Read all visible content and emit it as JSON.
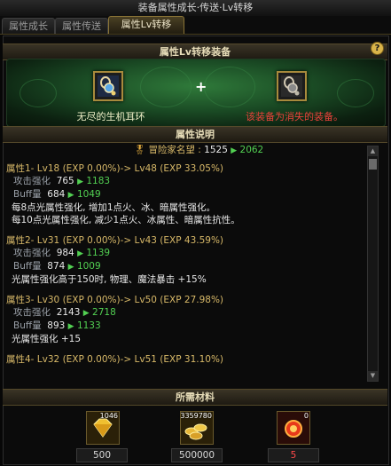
{
  "window": {
    "title": "装备属性成长·传送·Lv转移"
  },
  "tabs": [
    {
      "label": "属性成长",
      "active": false
    },
    {
      "label": "属性传送",
      "active": false
    },
    {
      "label": "属性Lv转移",
      "active": true
    }
  ],
  "transfer": {
    "header": "属性Lv转移装备",
    "help_glyph": "?",
    "plus": "+",
    "source_item_name": "无尽的生机耳环",
    "target_note": "该装备为消失的装备。"
  },
  "description": {
    "header": "属性说明",
    "adventure_fame": {
      "label": "冒险家名望 :",
      "from": "1525",
      "to": "2062"
    },
    "blocks": [
      {
        "title": "属性1- Lv18 (EXP 0.00%)-> Lv48 (EXP 33.05%)",
        "stats": [
          {
            "label": "攻击强化",
            "from": "765",
            "to": "1183"
          },
          {
            "label": "Buff量",
            "from": "684",
            "to": "1049"
          }
        ],
        "notes": [
          "每8点光属性强化, 增加1点火、冰、暗属性强化。",
          "每10点光属性强化, 减少1点火、冰属性、暗属性抗性。"
        ]
      },
      {
        "title": "属性2- Lv31 (EXP 0.00%)-> Lv43 (EXP 43.59%)",
        "stats": [
          {
            "label": "攻击强化",
            "from": "984",
            "to": "1139"
          },
          {
            "label": "Buff量",
            "from": "874",
            "to": "1009"
          }
        ],
        "notes": [
          "光属性强化高于150时, 物理、魔法暴击 +15%"
        ]
      },
      {
        "title": "属性3- Lv30 (EXP 0.00%)-> Lv50 (EXP 27.98%)",
        "stats": [
          {
            "label": "攻击强化",
            "from": "2143",
            "to": "2718"
          },
          {
            "label": "Buff量",
            "from": "893",
            "to": "1133"
          }
        ],
        "notes": [
          "光属性强化 +15"
        ]
      },
      {
        "title": "属性4- Lv32 (EXP 0.00%)-> Lv51 (EXP 31.10%)",
        "stats": [],
        "notes": []
      }
    ]
  },
  "materials": {
    "header": "所需材料",
    "items": [
      {
        "icon": "gold-diamond-icon",
        "stock": "1046",
        "required": "500",
        "required_color": "#d8d8d8"
      },
      {
        "icon": "gold-coins-icon",
        "stock": "3359780",
        "required": "500000",
        "required_color": "#d8d8d8"
      },
      {
        "icon": "red-orb-icon",
        "stock": "0",
        "required": "5",
        "required_color": "#ff4a4a"
      }
    ]
  },
  "colors": {
    "accent_gold": "#d7b868",
    "positive_green": "#52d052",
    "warning_red": "#e8423a"
  }
}
